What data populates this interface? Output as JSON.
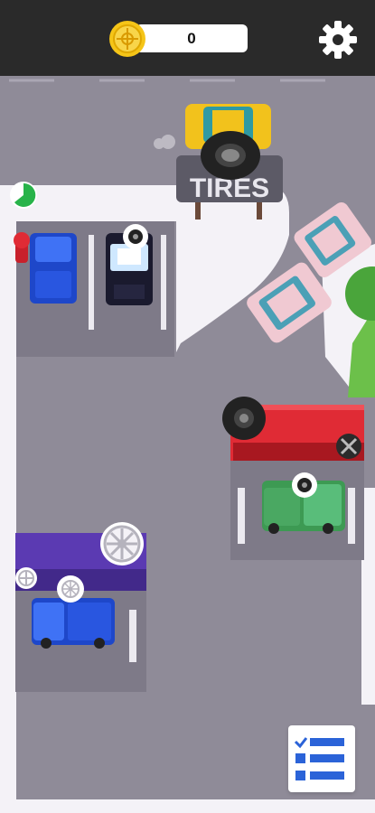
{
  "hud": {
    "coins": "0",
    "coin_icon": "coin-icon",
    "settings_icon": "gear-icon",
    "tasks_icon": "checklist-icon"
  },
  "world": {
    "shop_sign": "TIRES",
    "station_icons": [
      "tire-stack",
      "tire-rim",
      "tire-change-station"
    ],
    "request_bubbles": [
      "tire-request",
      "tire-request",
      "rim-request"
    ]
  },
  "colors": {
    "topbar": "#2a2a2a",
    "asphalt": "#8f8b98",
    "sidewalk": "#f4f2f7",
    "accent_red": "#e02b35",
    "accent_purple": "#5b3ab2",
    "coin": "#f5c518"
  }
}
